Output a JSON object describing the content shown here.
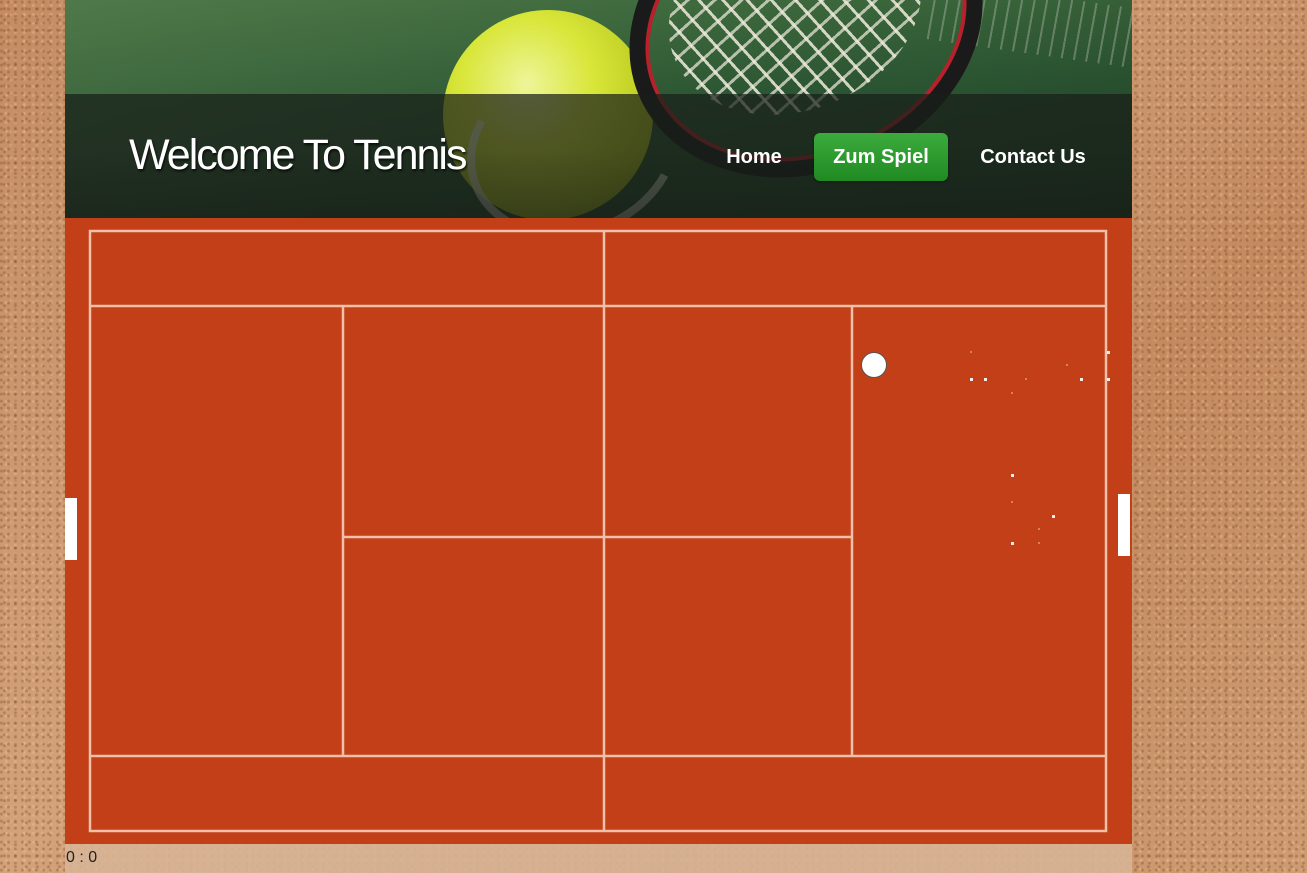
{
  "header": {
    "title": "Welcome To Tennis",
    "image": "tennis-ball-and-racket-photo"
  },
  "nav": {
    "home": "Home",
    "game": "Zum Spiel",
    "contact": "Contact Us",
    "active": "game",
    "active_color": "#239326"
  },
  "game": {
    "court_color": "#c23f18",
    "line_color": "#f0c0a8",
    "score": "0 : 0"
  }
}
